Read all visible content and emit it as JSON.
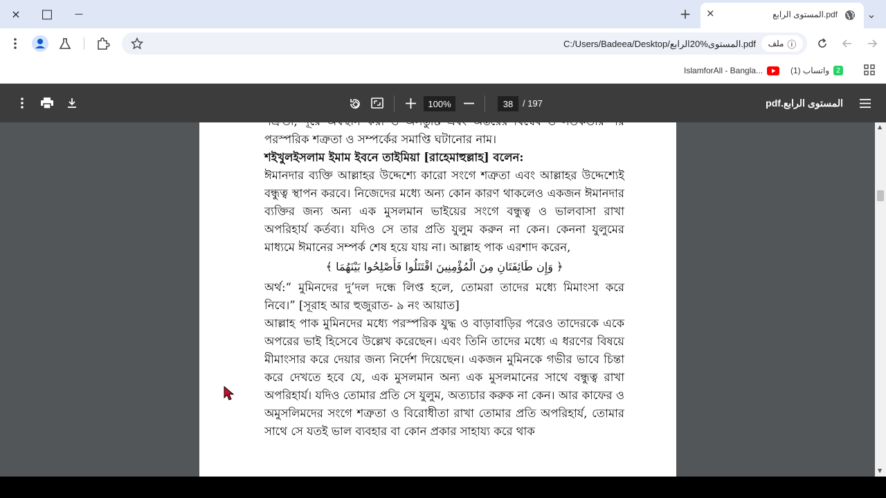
{
  "window": {
    "close_icon": "×",
    "maximize_icon": "□",
    "minimize_icon": "—"
  },
  "tabs": {
    "new_tab_icon": "+",
    "active_tab": {
      "title": "pdf.المستوى الرابع",
      "close_icon": "×"
    },
    "tab_search_icon": "⌄"
  },
  "toolbar": {
    "url": "C:/Users/Badeea/Desktop/المستوى%20الرابع.pdf",
    "file_chip": "ملف",
    "info_icon": "ⓘ"
  },
  "bookmarks": [
    {
      "label": "IslamforAll - Bangla...",
      "icon": "youtube-icon",
      "color": "#ff0000"
    },
    {
      "label": "(1) واتساب",
      "icon": "whatsapp-icon",
      "badge": "2",
      "color": "#25d366"
    }
  ],
  "pdf_toolbar": {
    "zoom": "100%",
    "page_current": "38",
    "page_total": "/ 197",
    "file_name": "pdf.المستوى الرابع"
  },
  "document": {
    "paragraphs": [
      {
        "type": "text",
        "text": "শত্রুতা, দূরে অবস্থান করা ও অসন্তুষ্টি এবং অন্তরের বিদ্বেষ ও সতর্কতার পর পরস্পরিক শত্রুতা ও সম্পর্কের সমাপ্তি ঘটানোর নাম।"
      },
      {
        "type": "heading",
        "text": "শইখুলইসলাম ইমাম ইবনে তাইমিয়া [রাহেমাহুল্লাহ] বলেন:"
      },
      {
        "type": "text",
        "text": "ঈমানদার ব্যক্তি আল্লাহর উদ্দেশ্যে কারো সংগে শত্রুতা এবং আল্লাহর উদ্দেশ্যেই বন্ধুত্ব স্থাপন করবে। নিজেদের মধ্যে অন্য কোন কারণ থাকলেও একজন ঈমানদার ব্যক্তির জন্য অন্য এক মুসলমান ভাইয়ের সংগে বন্ধুত্ব ও ভালবাসা রাখা অপরিহার্য কর্তব্য। যদিও সে তার প্রতি যুলুম করুন না কেন। কেননা যুলুমের মাধ্যমে ঈমানের সম্পর্ক শেষ হয়ে যায় না। আল্লাহ পাক এরশাদ করেন,"
      },
      {
        "type": "arabic",
        "text": "﴿ وَإِن طَائِفَتَانِ مِنَ الْمُؤْمِنِينَ اقْتَتَلُوا فَأَصْلِحُوا بَيْنَهُمَا ﴾"
      },
      {
        "type": "text",
        "text": "অর্থ:“ মুমিনদের দু’দল দন্ধে লিপ্ত হলে, তোমরা তাদের মধ্যে মিমাংসা করে নিবে।” [সূরাহ আর হুজুরাত- ৯ নং আয়াত]"
      },
      {
        "type": "text",
        "text": "আল্লাহ পাক মুমিনদের মধ্যে পরস্পরিক যুদ্ধ ও বাড়াবাড়ির পরেও তাদেরকে একে অপরের ভাই হিসেবে উল্লেখ করেছেন। এবং তিনি তাদের মধ্যে এ ধরণের বিষয়ে মীমাংসার করে দেয়ার জন্য নির্দেশ দিয়েছেন। একজন মুমিনকে গভীর ভাবে চিন্তা করে দেখতে হবে যে, এক মুসলমান অন্য এক মুসলমানের সাথে বন্ধুত্ব রাখা অপরিহার্য। যদিও তোমার প্রতি সে যুলুম, অত্যচার করুক না কেন। আর কাফের ও অমুসলিমদের সংগে শত্রুতা ও বিরোধীতা রাখা তোমার প্রতি অপরিহার্য, তোমার সাথে সে যতই ভাল ব্যবহার বা কোন প্রকার সাহায্য করে থাক"
      }
    ]
  }
}
